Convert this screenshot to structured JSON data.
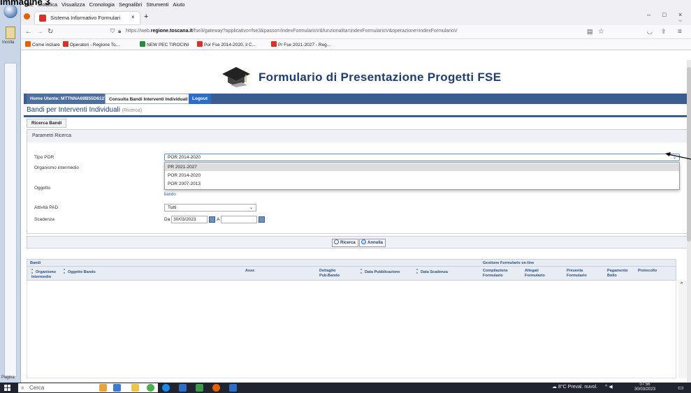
{
  "caption": "Immagine 3",
  "office": {
    "paste_label": "Incolla",
    "pages_label": "Pagina"
  },
  "menu": [
    "File",
    "Modifica",
    "Visualizza",
    "Cronologia",
    "Segnalibri",
    "Strumenti",
    "Aiuto"
  ],
  "tab": {
    "title": "Sistema Informativo Formulari",
    "close": "×",
    "new": "+"
  },
  "window_controls": {
    "minimize": "–",
    "maximize": "□",
    "close": "×",
    "list": "⌵"
  },
  "address": {
    "prefix": "https://web.",
    "domain": "regione.toscana.it",
    "path": "/fse3/gateway?applicativo=fse3&passo=/indexFormularioV&funzionalita=indexFormularioV&operazione=indexFormularioV"
  },
  "bookmarks": [
    {
      "label": "Come iniziare",
      "color": "#e66000"
    },
    {
      "label": "Operatori - Regione To...",
      "color": "#d8312a"
    },
    {
      "label": "NEW PEC TIROCINI",
      "color": "#2a8a3a"
    },
    {
      "label": "Por Fse 2014-2020, il C...",
      "color": "#d8312a"
    },
    {
      "label": "Pr Fse 2021-2027 - Reg...",
      "color": "#d8312a"
    }
  ],
  "page": {
    "title": "Formulario di Presentazione Progetti FSE",
    "nav": {
      "home": "Home Utente: MTTNNA69B55D612T",
      "bandi": "Consulta Bandi Interventi Individuali",
      "logout": "Logout"
    },
    "section_title": "Bandi per Interventi Individuali",
    "section_sub": "(Ricerca)",
    "search_tab": "Ricerca Bandi",
    "params_title": "Parametri Ricerca",
    "fields": {
      "tipo_por": "Tipo POR",
      "organismo": "Organismo intermedio",
      "oggetto": "Oggetto",
      "attivita": "Attività PAD",
      "scadenza": "Scadenza"
    },
    "tipo_por_value": "POR 2014-2020",
    "dropdown_options": [
      "PR 2021-2027",
      "POR 2014-2020",
      "POR 2007-2013"
    ],
    "bando_label": "bando",
    "attivita_value": "Tutti",
    "date_from_label": "Da",
    "date_from": "30/03/2023",
    "date_to_label": "A",
    "buttons": {
      "search": "Ricerca",
      "cancel": "Annulla"
    },
    "table": {
      "group_left": "Bandi",
      "group_right": "Gestione Formulario on-line",
      "columns": [
        "Organismo Intermedio",
        "Oggetto Bando",
        "Asse",
        "Dettaglio Pub.Bando",
        "Data Pubblicazione",
        "Data Scadenza",
        "Compilazione Formulario",
        "Allegati Formulario",
        "Presenta Formulario",
        "Pagamento Bollo",
        "Protocollo"
      ]
    }
  },
  "taskbar": {
    "search_placeholder": "Cerca",
    "weather": "8°C Preval. nuvol.",
    "time": "07:56",
    "date": "30/03/2023"
  }
}
